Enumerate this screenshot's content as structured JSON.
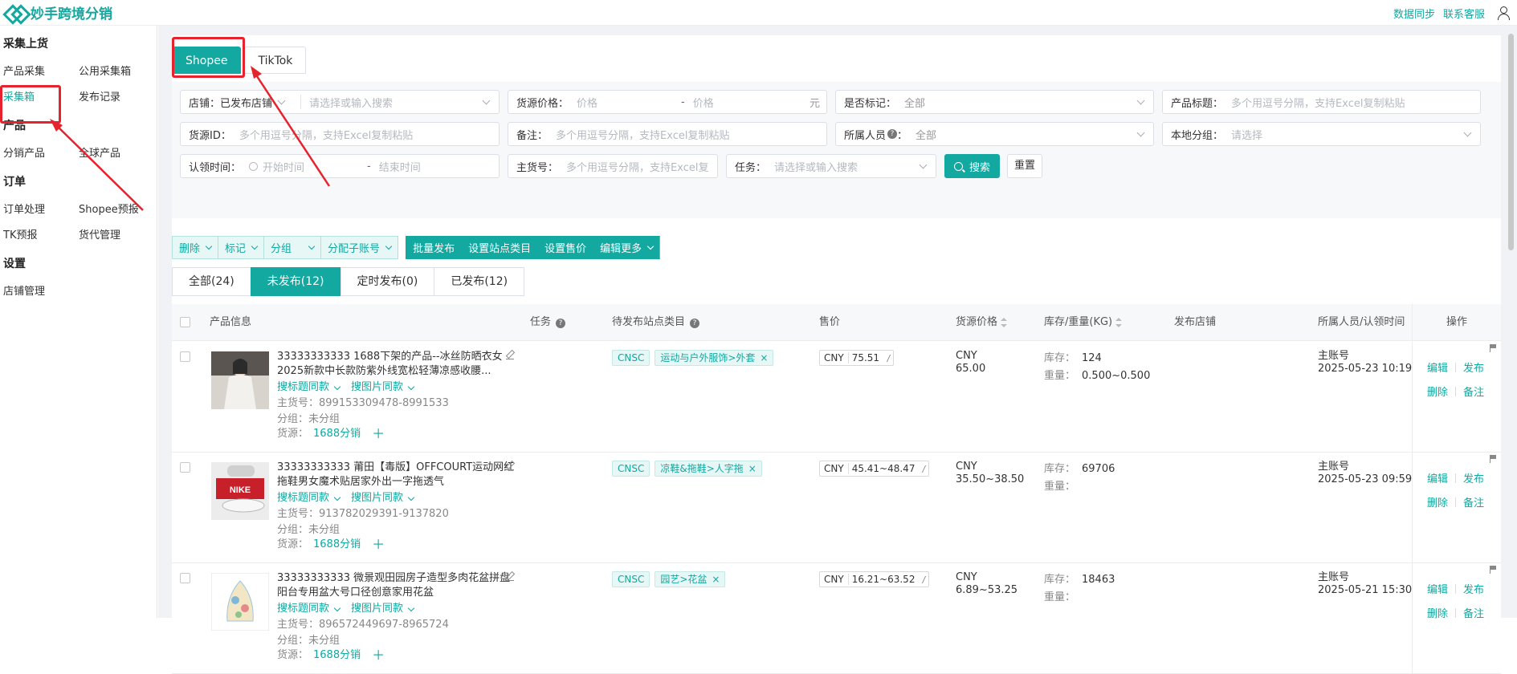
{
  "app": {
    "title": "妙手跨境分销",
    "top_links": [
      "数据同步",
      "联系客服"
    ]
  },
  "sidebar": {
    "sections": [
      {
        "title": "采集上货",
        "rows": [
          [
            "产品采集",
            "公用采集箱"
          ],
          [
            "采集箱",
            "发布记录"
          ]
        ]
      },
      {
        "title": "产品",
        "rows": [
          [
            "分销产品",
            "全球产品"
          ]
        ]
      },
      {
        "title": "订单",
        "rows": [
          [
            "订单处理",
            "Shopee预报"
          ],
          [
            "TK预报",
            "货代管理"
          ]
        ]
      },
      {
        "title": "设置",
        "rows": [
          [
            "店铺管理",
            ""
          ]
        ]
      }
    ],
    "active": "采集箱"
  },
  "tabs": [
    "Shopee",
    "TikTok"
  ],
  "filters": {
    "store_label": "店铺：",
    "store_value": "已发布店铺",
    "store_search_ph": "请选择或输入搜索",
    "price_label": "货源价格：",
    "price_min_ph": "价格",
    "price_dash": "-",
    "price_max_ph": "价格",
    "price_unit": "元",
    "marked_label": "是否标记：",
    "marked_value": "全部",
    "title_label": "产品标题：",
    "title_ph": "多个用逗号分隔，支持Excel复制粘贴",
    "srcid_label": "货源ID：",
    "srcid_ph": "多个用逗号分隔，支持Excel复制粘贴",
    "remark_label": "备注：",
    "remark_ph": "多个用逗号分隔，支持Excel复制粘贴",
    "owner_label": "所属人员",
    "owner_value": "全部",
    "group_label": "本地分组：",
    "group_ph": "请选择",
    "claim_label": "认领时间：",
    "claim_start_ph": "开始时间",
    "claim_dash": "-",
    "claim_end_ph": "结束时间",
    "sku_label": "主货号：",
    "sku_ph": "多个用逗号分隔，支持Excel复",
    "task_label": "任务：",
    "task_ph": "请选择或输入搜索",
    "search_btn": "搜索",
    "reset_btn": "重置"
  },
  "actions": {
    "outline": [
      "删除",
      "标记",
      "分组",
      "分配子账号"
    ],
    "solid": [
      "批量发布",
      "设置站点类目",
      "设置售价",
      "编辑更多"
    ]
  },
  "status_tabs": [
    {
      "label": "全部(24)",
      "active": false
    },
    {
      "label": "未发布(12)",
      "active": true
    },
    {
      "label": "定时发布(0)",
      "active": false
    },
    {
      "label": "已发布(12)",
      "active": false
    }
  ],
  "columns": {
    "product": "产品信息",
    "task": "任务",
    "category": "待发布站点类目",
    "price": "售价",
    "src_price": "货源价格",
    "stock": "库存/重量(KG)",
    "store": "发布店铺",
    "owner": "所属人员/认领时间",
    "ops": "操作"
  },
  "rows": [
    {
      "title": "33333333333 1688下架的产品--冰丝防晒衣女2025新款中长款防紫外线宽松轻薄凉感收腰...",
      "link1": "搜标题同款",
      "link2": "搜图片同款",
      "sku": "主货号：899153309478-8991533",
      "group": "分组：未分组",
      "source_label": "货源：",
      "source": "1688分销",
      "site": "CNSC",
      "category": "运动与户外服饰>外套",
      "currency": "CNY",
      "price": "75.51",
      "src_cur": "CNY",
      "src_price": "65.00",
      "stock_label": "库存：",
      "stock": "124",
      "weight_label": "重量：",
      "weight": "0.500~0.500",
      "owner": "主账号",
      "time": "2025-05-23 10:19",
      "ops": [
        "编辑",
        "发布",
        "删除",
        "备注"
      ],
      "thumb_colors": [
        "#2d2d2d",
        "#d9d3ce"
      ]
    },
    {
      "title": "33333333333 莆田【毒版】OFFCOURT运动网红拖鞋男女魔术贴居家外出一字拖透气",
      "link1": "搜标题同款",
      "link2": "搜图片同款",
      "sku": "主货号：913782029391-9137820",
      "group": "分组：未分组",
      "source_label": "货源：",
      "source": "1688分销",
      "site": "CNSC",
      "category": "凉鞋&拖鞋>人字拖",
      "currency": "CNY",
      "price": "45.41~48.47",
      "src_cur": "CNY",
      "src_price": "35.50~38.50",
      "stock_label": "库存：",
      "stock": "69706",
      "weight_label": "重量：",
      "weight": "",
      "owner": "主账号",
      "time": "2025-05-23 09:59",
      "ops": [
        "编辑",
        "发布",
        "删除",
        "备注"
      ],
      "thumb_colors": [
        "#c8202a",
        "#e8e8e8"
      ]
    },
    {
      "title": "33333333333 微景观田园房子造型多肉花盆拼盘阳台专用盆大号口径创意家用花盆",
      "link1": "搜标题同款",
      "link2": "搜图片同款",
      "sku": "主货号：896572449697-8965724",
      "group": "分组：未分组",
      "source_label": "货源：",
      "source": "1688分销",
      "site": "CNSC",
      "category": "园艺>花盆",
      "currency": "CNY",
      "price": "16.21~63.52",
      "src_cur": "CNY",
      "src_price": "6.89~53.25",
      "stock_label": "库存：",
      "stock": "18463",
      "weight_label": "重量：",
      "weight": "",
      "owner": "主账号",
      "time": "2025-05-21 15:30",
      "ops": [
        "编辑",
        "发布",
        "删除",
        "备注"
      ],
      "thumb_colors": [
        "#7fb7d9",
        "#f2e6c4"
      ]
    }
  ]
}
